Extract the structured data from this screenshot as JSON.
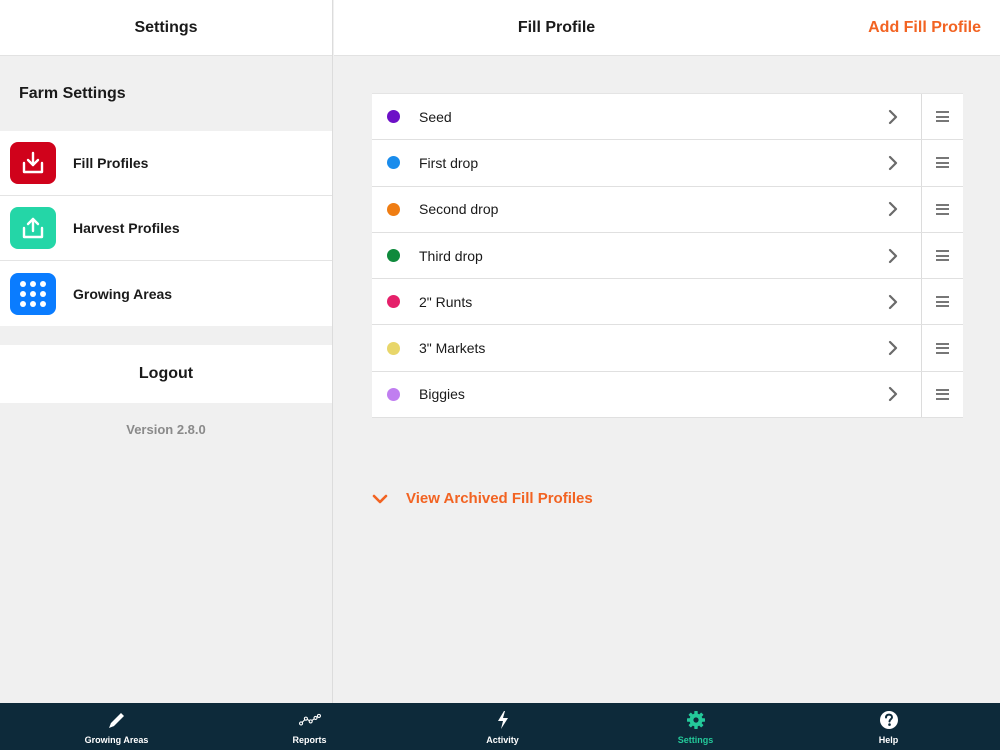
{
  "sidebar": {
    "title": "Settings",
    "section_title": "Farm Settings",
    "items": [
      {
        "label": "Fill Profiles",
        "icon": "download-tray-icon",
        "color": "#d0021b"
      },
      {
        "label": "Harvest Profiles",
        "icon": "upload-tray-icon",
        "color": "#24d6a7"
      },
      {
        "label": "Growing Areas",
        "icon": "grid-dots-icon",
        "color": "#0a7cff"
      }
    ],
    "logout_label": "Logout",
    "version": "Version 2.8.0"
  },
  "main": {
    "title": "Fill Profile",
    "add_label": "Add Fill Profile",
    "profiles": [
      {
        "label": "Seed",
        "color": "#6d10c7"
      },
      {
        "label": "First drop",
        "color": "#1a8cec"
      },
      {
        "label": "Second drop",
        "color": "#ef7d13"
      },
      {
        "label": "Third drop",
        "color": "#0f8a3c"
      },
      {
        "label": "2\" Runts",
        "color": "#e5206a"
      },
      {
        "label": "3\" Markets",
        "color": "#e8d66a"
      },
      {
        "label": "Biggies",
        "color": "#c07ef0"
      }
    ],
    "archived_label": "View Archived Fill Profiles"
  },
  "tabbar": {
    "tabs": [
      {
        "label": "Growing Areas",
        "icon": "pencil-icon"
      },
      {
        "label": "Reports",
        "icon": "line-graph-icon"
      },
      {
        "label": "Activity",
        "icon": "lightning-icon"
      },
      {
        "label": "Settings",
        "icon": "gear-icon",
        "active": true
      },
      {
        "label": "Help",
        "icon": "help-icon"
      }
    ]
  },
  "colors": {
    "accent": "#f26322",
    "tab_active": "#24c99a",
    "tabbar_bg": "#0d2a3a"
  }
}
